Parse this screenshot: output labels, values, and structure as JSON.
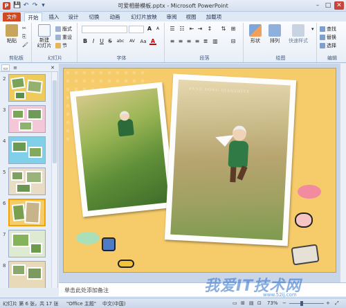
{
  "window": {
    "title": "可爱相册模板.pptx - Microsoft PowerPoint",
    "app_icon": "P",
    "controls": {
      "minimize": "–",
      "maximize": "□",
      "close": "✕"
    }
  },
  "qat": {
    "save": "💾",
    "undo": "↶",
    "redo": "↷",
    "customize": "▾"
  },
  "tabs": [
    "文件",
    "开始",
    "插入",
    "设计",
    "切换",
    "动画",
    "幻灯片放映",
    "审阅",
    "视图",
    "加载项"
  ],
  "ribbon": {
    "clipboard": {
      "paste": "粘贴",
      "label": "剪贴板"
    },
    "slides": {
      "new_slide": "新建\n幻灯片",
      "layout": "版式",
      "reset": "重设",
      "section": "节",
      "label": "幻灯片"
    },
    "font": {
      "bold": "B",
      "italic": "I",
      "underline": "U",
      "strike": "S",
      "shadow": "abc",
      "spacing": "AV",
      "case": "Aa",
      "color": "A",
      "label": "字体"
    },
    "paragraph": {
      "label": "段落"
    },
    "drawing": {
      "shapes": "形状",
      "arrange": "排列",
      "quick_styles": "快速样式",
      "label": "绘图"
    },
    "editing": {
      "find": "查找",
      "replace": "替换",
      "select": "选择",
      "label": "编辑"
    }
  },
  "panel_tabs": {
    "slides_icon": "▭",
    "outline_icon": "≡",
    "close": "✕"
  },
  "slides": [
    {
      "num": "2",
      "selected": false
    },
    {
      "num": "3",
      "selected": false
    },
    {
      "num": "4",
      "selected": false
    },
    {
      "num": "5",
      "selected": false
    },
    {
      "num": "6",
      "selected": true
    },
    {
      "num": "7",
      "selected": false
    },
    {
      "num": "8",
      "selected": false
    }
  ],
  "slide_content": {
    "caption": "PANG DONG QIANZHIYE"
  },
  "notes": {
    "placeholder": "单击此处添加备注"
  },
  "status": {
    "slide_info": "幻灯片 第 6 张，共 17 张",
    "theme": "\"Office 主题\"",
    "language": "中文(中国)",
    "zoom": "73%"
  },
  "watermark": {
    "text": "我爱IT技术网",
    "url": "www.52ij.com"
  },
  "colors": {
    "accent_file_tab": "#cf4a22",
    "slide_bg": "#f6cb6a",
    "selection": "#f2a300"
  }
}
